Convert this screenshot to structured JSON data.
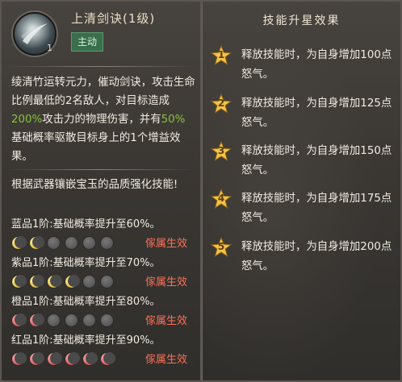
{
  "skill": {
    "name": "上清剑诀(1级)",
    "type_tag": "主动",
    "level_badge": "1",
    "icon": "sword-slash-icon",
    "description_parts": {
      "p1": "绫清竹运转元力，催动剑诀，攻击生命比例最低的2名敌人，对目标造成",
      "p1_hl": "200%",
      "p2": "攻击力的物理伤害，并有",
      "p2_hl": "50%",
      "p3": "基础概率驱散目标身上的1个增益效果。"
    }
  },
  "enhance": {
    "title": "根据武器镶嵌宝玉的品质强化技能!",
    "tiers": [
      {
        "label": "蓝品1阶:基础概率提升至60%。",
        "effect": "傢属生效",
        "dot_color": "gold",
        "lit": 2,
        "total": 6
      },
      {
        "label": "紫品1阶:基础概率提升至70%。",
        "effect": "傢属生效",
        "dot_color": "gold",
        "lit": 4,
        "total": 6
      },
      {
        "label": "橙品1阶:基础概率提升至80%。",
        "effect": "傢属生效",
        "dot_color": "red",
        "lit": 2,
        "total": 6
      },
      {
        "label": "红品1阶:基础概率提升至90%。",
        "effect": "傢属生效",
        "dot_color": "red",
        "lit": 6,
        "total": 6
      }
    ]
  },
  "star_panel": {
    "title": "技能升星效果",
    "items": [
      {
        "num": "1",
        "text": "释放技能时，为自身增加100点怒气。"
      },
      {
        "num": "2",
        "text": "释放技能时，为自身增加125点怒气。"
      },
      {
        "num": "3",
        "text": "释放技能时，为自身增加150点怒气。"
      },
      {
        "num": "4",
        "text": "释放技能时，为自身增加175点怒气。"
      },
      {
        "num": "5",
        "text": "释放技能时，为自身增加200点怒气。"
      }
    ]
  },
  "colors": {
    "highlight_green": "#89c23d",
    "effect_red": "#ff6f55",
    "tag_green": "#3a6f4d",
    "star_gold": "#f2c24a"
  }
}
